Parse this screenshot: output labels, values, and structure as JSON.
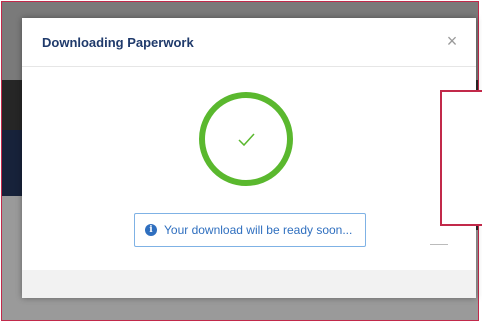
{
  "modal": {
    "title": "Downloading Paperwork",
    "close_glyph": "×",
    "status_icon": "check-circle-icon",
    "info_message": "Your download will be ready soon...",
    "info_icon_glyph": "i"
  },
  "colors": {
    "accent_green": "#5ab82e",
    "title_navy": "#1f3a6b",
    "info_blue": "#2f6fbf",
    "highlight_red": "#c2294a"
  }
}
